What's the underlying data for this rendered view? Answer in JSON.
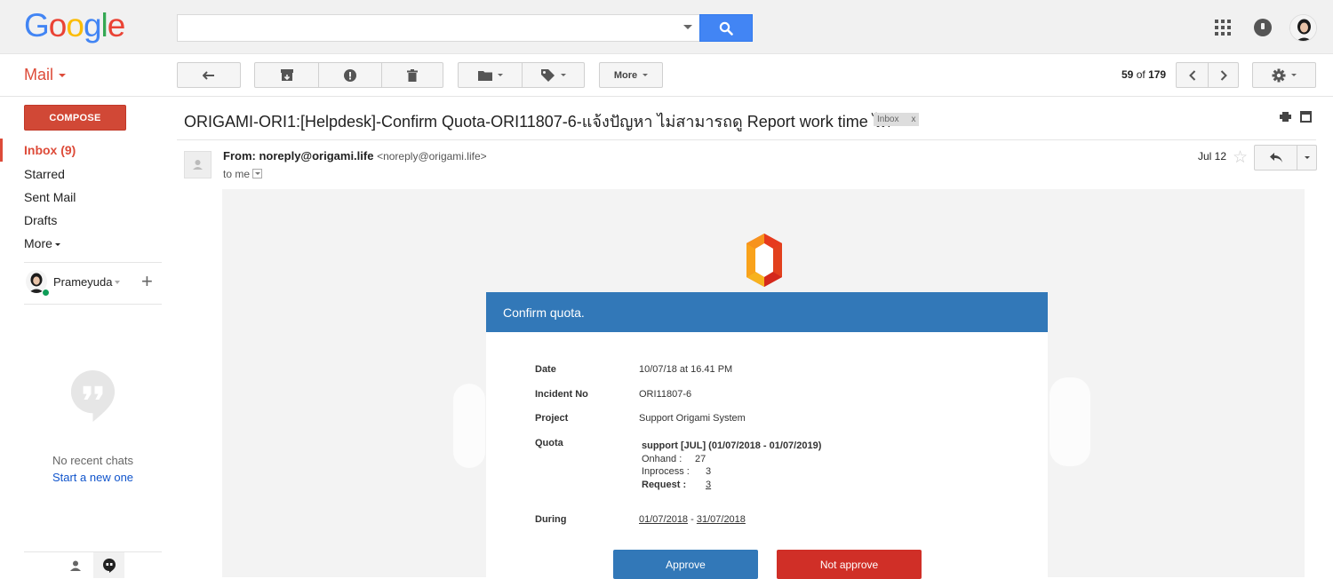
{
  "header": {
    "logo_letters": [
      {
        "ch": "G",
        "color": "#4285f4"
      },
      {
        "ch": "o",
        "color": "#ea4335"
      },
      {
        "ch": "o",
        "color": "#fbbc05"
      },
      {
        "ch": "g",
        "color": "#4285f4"
      },
      {
        "ch": "l",
        "color": "#34a853"
      },
      {
        "ch": "e",
        "color": "#ea4335"
      }
    ],
    "search": {
      "value": "",
      "placeholder": ""
    },
    "icons": [
      "apps-icon",
      "notifications-icon",
      "account-avatar"
    ]
  },
  "toolbar": {
    "app_label": "Mail",
    "more_label": "More",
    "pager": {
      "current": "59",
      "of_word": "of",
      "total": "179"
    }
  },
  "sidebar": {
    "compose_label": "COMPOSE",
    "items": [
      {
        "label": "Inbox (9)",
        "active": true
      },
      {
        "label": "Starred",
        "active": false
      },
      {
        "label": "Sent Mail",
        "active": false
      },
      {
        "label": "Drafts",
        "active": false
      },
      {
        "label": "More",
        "active": false
      }
    ],
    "user_name": "Prameyuda",
    "no_chats": "No recent chats",
    "start_chat": "Start a new one"
  },
  "message": {
    "subject": "ORIGAMI-ORI1:[Helpdesk]-Confirm Quota-ORI11807-6-แจ้งปัญหา ไม่สามารถดู Report work time ได้",
    "label_tag": "Inbox",
    "label_tag_close": "x",
    "from_prefix": "From:",
    "from_email": "noreply@origami.life",
    "from_addr": "<noreply@origami.life>",
    "to": "to me",
    "date": "Jul 12"
  },
  "email_card": {
    "title": "Confirm quota.",
    "date_label": "Date",
    "date_value": "10/07/18 at 16.41 PM",
    "incident_label": "Incident No",
    "incident_value": "ORI11807-6",
    "project_label": "Project",
    "project_value": "Support Origami System",
    "quota_label": "Quota",
    "quota_title": "support [JUL] (01/07/2018 - 01/07/2019)",
    "onhand_label": "Onhand :",
    "onhand_value": "27",
    "inprocess_label": "Inprocess :",
    "inprocess_value": "3",
    "request_label": "Request :",
    "request_value": "3",
    "during_label": "During",
    "during_start": "01/07/2018",
    "during_sep": "-",
    "during_end": "31/07/2018",
    "approve_label": "Approve",
    "reject_label": "Not approve"
  },
  "colors": {
    "compose": "#d14836",
    "search_button": "#4285f4",
    "card_header": "#3278b8",
    "approve": "#3278b8",
    "reject": "#d02f27"
  }
}
